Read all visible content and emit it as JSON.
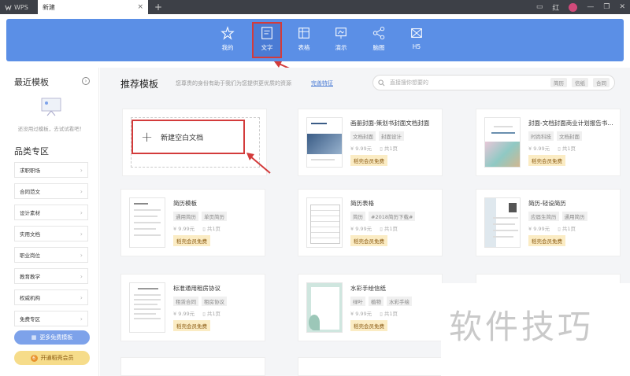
{
  "titlebar": {
    "app": "WPS",
    "tab": "新建",
    "close": "×",
    "plus": "+",
    "user": "红"
  },
  "ribbon": {
    "items": [
      {
        "label": "我的",
        "icon": "star-doc-icon"
      },
      {
        "label": "文字",
        "icon": "doc-icon",
        "active": true
      },
      {
        "label": "表格",
        "icon": "table-icon"
      },
      {
        "label": "演示",
        "icon": "presentation-icon"
      },
      {
        "label": "脑图",
        "icon": "mindmap-icon"
      },
      {
        "label": "H5",
        "icon": "h5-icon"
      }
    ]
  },
  "sidebar": {
    "recent_title": "最近模板",
    "empty_text": "还没用过模板，去试试看吧！",
    "category_title": "品类专区",
    "categories": [
      "求职职场",
      "合同范文",
      "设计素材",
      "实用文档",
      "职业岗位",
      "教育教学",
      "权威机构",
      "免费专区"
    ],
    "more_button": "更多免费模板",
    "vip_button": "开通稻壳会员",
    "vip_badge": "6"
  },
  "main": {
    "title": "推荐模板",
    "subtitle": "您尊贵的身份有助于我们为您提供更优质的资源",
    "link": "完善特征",
    "search": {
      "placeholder": "直接搜你想要的",
      "tags": [
        "简历",
        "信纸",
        "合同"
      ]
    },
    "new_blank": "新建空白文档",
    "templates": [
      {
        "title": "画册封面-策划书封面文档封面",
        "tags": [
          "文档封面",
          "封面设计"
        ],
        "price": "9.99元",
        "pages": "共1页",
        "free": "稻壳会员免费"
      },
      {
        "title": "封面-文档封面商业计划报告书封面",
        "tags": [
          "时尚科技",
          "文档封面"
        ],
        "price": "9.99元",
        "pages": "共1页",
        "free": "稻壳会员免费"
      },
      {
        "title": "简历模板",
        "tags": [
          "通用简历",
          "单页简历"
        ],
        "price": "9.99元",
        "pages": "共1页",
        "free": "稻壳会员免费"
      },
      {
        "title": "简历表格",
        "tags": [
          "简历",
          "#2018简历下载#"
        ],
        "price": "9.99元",
        "pages": "共1页",
        "free": "稻壳会员免费"
      },
      {
        "title": "简历-轻设简历",
        "tags": [
          "应届生简历",
          "通用简历"
        ],
        "price": "9.99元",
        "pages": "共1页",
        "free": "稻壳会员免费"
      },
      {
        "title": "标准通用租房协议",
        "tags": [
          "租赁合同",
          "租房协议"
        ],
        "price": "9.99元",
        "pages": "共1页",
        "free": "稻壳会员免费"
      },
      {
        "title": "水彩手绘信纸",
        "tags": [
          "绿叶",
          "植物",
          "水彩手绘"
        ],
        "price": "9.99元",
        "pages": "共1页",
        "free": "稻壳会员免费"
      }
    ]
  },
  "watermark": "软件技巧",
  "colors": {
    "accent": "#5b8fe6",
    "highlight": "#d33b3b",
    "vip": "#f6dc8a"
  }
}
